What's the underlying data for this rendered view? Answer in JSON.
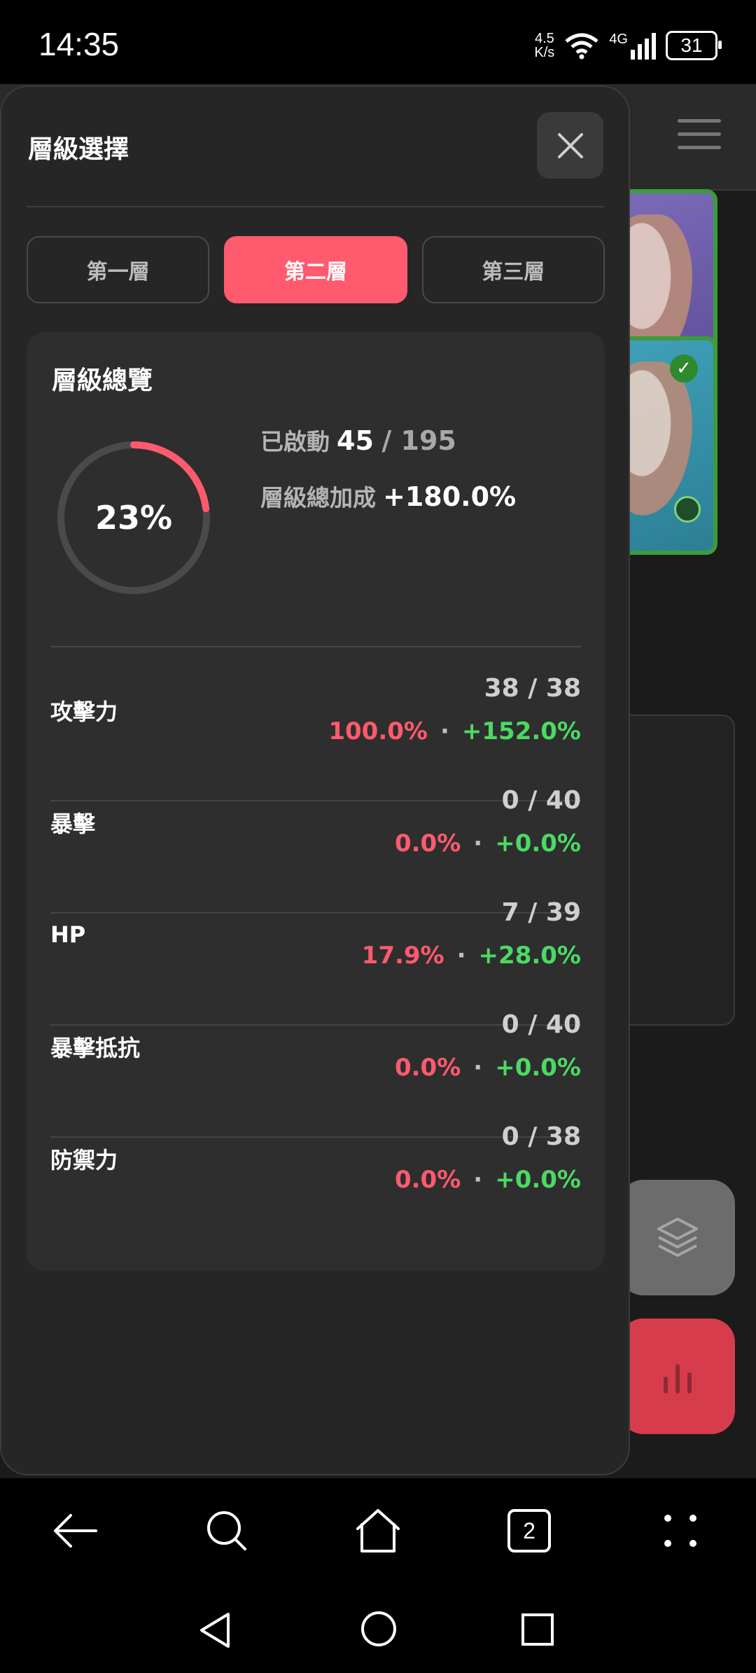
{
  "status_bar": {
    "time": "14:35",
    "net_speed_value": "4.5",
    "net_speed_unit": "K/s",
    "network": "4G",
    "battery": "31"
  },
  "drawer": {
    "title": "層級選擇",
    "tabs": [
      {
        "label": "第一層",
        "active": false
      },
      {
        "label": "第二層",
        "active": true
      },
      {
        "label": "第三層",
        "active": false
      }
    ],
    "overview": {
      "title": "層級總覽",
      "progress_percent": 23,
      "progress_label": "23%",
      "activated_label": "已啟動",
      "activated_count": "45",
      "activated_total": "/ 195",
      "bonus_label": "層級總加成",
      "bonus_value": "+180.0%"
    },
    "stats": [
      {
        "name": "攻擊力",
        "count": "38 / 38",
        "pct": "100.0%",
        "bonus": "+152.0%"
      },
      {
        "name": "暴擊",
        "count": "0 / 40",
        "pct": "0.0%",
        "bonus": "+0.0%"
      },
      {
        "name": "HP",
        "count": "7 / 39",
        "pct": "17.9%",
        "bonus": "+28.0%"
      },
      {
        "name": "暴擊抵抗",
        "count": "0 / 40",
        "pct": "0.0%",
        "bonus": "+0.0%"
      },
      {
        "name": "防禦力",
        "count": "0 / 38",
        "pct": "0.0%",
        "bonus": "+0.0%"
      }
    ],
    "separator": "·"
  },
  "browser_bar": {
    "tab_count": "2"
  },
  "colors": {
    "accent": "#ff5a6e",
    "positive": "#4cd964",
    "panel": "#262626"
  }
}
